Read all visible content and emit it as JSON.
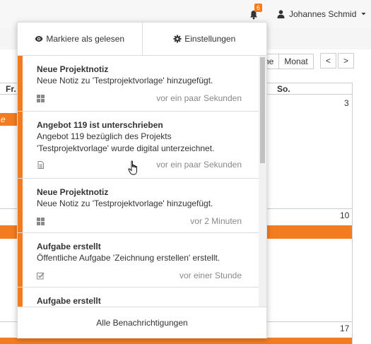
{
  "header": {
    "notification_count": "6",
    "user_name": "Johannes Schmid"
  },
  "calendar": {
    "view_buttons": [
      "ne",
      "Monat"
    ],
    "nav_prev": "<",
    "nav_next": ">",
    "col_fr": "Fr.",
    "col_so": "So.",
    "day_left_marker": "e",
    "days": [
      "3",
      "10",
      "17"
    ]
  },
  "dropdown": {
    "mark_read": "Markiere als gelesen",
    "settings": "Einstellungen",
    "footer": "Alle Benachrichtigungen",
    "notifications": [
      {
        "title": "Neue Projektnotiz",
        "text": "Neue Notiz zu 'Testprojektvorlage' hinzugefügt.",
        "time": "vor ein paar Sekunden",
        "icon": "grid-icon",
        "unread": true
      },
      {
        "title": "Angebot 119 ist unterschrieben",
        "text": "Angebot 119 bezüglich des Projekts 'Testprojektvorlage' wurde digital unterzeichnet.",
        "time": "vor ein paar Sekunden",
        "icon": "document-icon",
        "unread": true
      },
      {
        "title": "Neue Projektnotiz",
        "text": "Neue Notiz zu 'Testprojektvorlage' hinzugefügt.",
        "time": "vor 2 Minuten",
        "icon": "grid-icon",
        "unread": true
      },
      {
        "title": "Aufgabe erstellt",
        "text": "Öffentliche Aufgabe 'Zeichnung erstellen' erstellt.",
        "time": "vor einer Stunde",
        "icon": "checkbox-icon",
        "unread": true
      },
      {
        "title": "Aufgabe erstellt",
        "text": "",
        "time": "",
        "icon": "",
        "unread": true
      }
    ]
  },
  "colors": {
    "accent": "#f47c20"
  }
}
